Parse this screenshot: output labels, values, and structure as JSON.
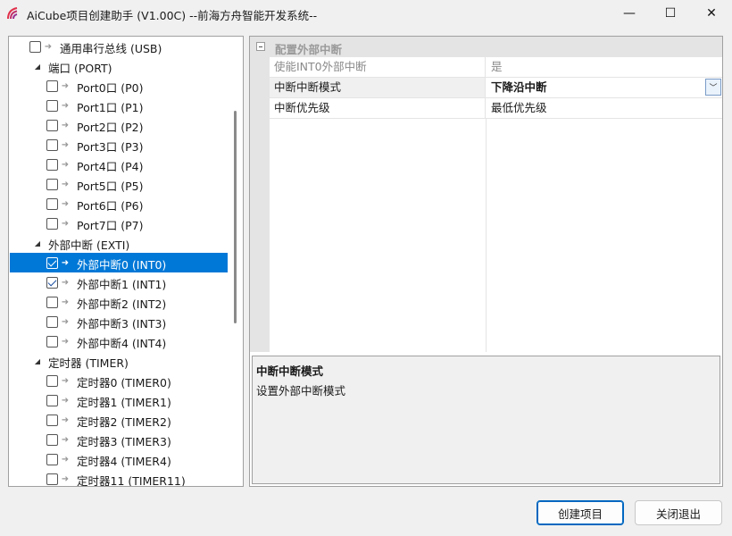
{
  "window": {
    "title": "AiCube项目创建助手 (V1.00C) --前海方舟智能开发系统--",
    "min_glyph": "—",
    "max_glyph": "☐",
    "close_glyph": "✕"
  },
  "tree": {
    "items": [
      {
        "label": "通用串行总线 (USB)",
        "checked": false,
        "level": 1,
        "type": "leaf",
        "selected": false
      },
      {
        "label": "端口 (PORT)",
        "level": 0,
        "type": "group",
        "expander": "◢"
      },
      {
        "label": "Port0口 (P0)",
        "checked": false,
        "level": 1,
        "type": "leaf",
        "selected": false
      },
      {
        "label": "Port1口 (P1)",
        "checked": false,
        "level": 1,
        "type": "leaf",
        "selected": false
      },
      {
        "label": "Port2口 (P2)",
        "checked": false,
        "level": 1,
        "type": "leaf",
        "selected": false
      },
      {
        "label": "Port3口 (P3)",
        "checked": false,
        "level": 1,
        "type": "leaf",
        "selected": false
      },
      {
        "label": "Port4口 (P4)",
        "checked": false,
        "level": 1,
        "type": "leaf",
        "selected": false
      },
      {
        "label": "Port5口 (P5)",
        "checked": false,
        "level": 1,
        "type": "leaf",
        "selected": false
      },
      {
        "label": "Port6口 (P6)",
        "checked": false,
        "level": 1,
        "type": "leaf",
        "selected": false
      },
      {
        "label": "Port7口 (P7)",
        "checked": false,
        "level": 1,
        "type": "leaf",
        "selected": false
      },
      {
        "label": "外部中断 (EXTI)",
        "level": 0,
        "type": "group",
        "expander": "◢"
      },
      {
        "label": "外部中断0 (INT0)",
        "checked": true,
        "level": 1,
        "type": "leaf",
        "selected": true
      },
      {
        "label": "外部中断1 (INT1)",
        "checked": true,
        "level": 1,
        "type": "leaf",
        "selected": false
      },
      {
        "label": "外部中断2 (INT2)",
        "checked": false,
        "level": 1,
        "type": "leaf",
        "selected": false
      },
      {
        "label": "外部中断3 (INT3)",
        "checked": false,
        "level": 1,
        "type": "leaf",
        "selected": false
      },
      {
        "label": "外部中断4 (INT4)",
        "checked": false,
        "level": 1,
        "type": "leaf",
        "selected": false
      },
      {
        "label": "定时器 (TIMER)",
        "level": 0,
        "type": "group",
        "expander": "◢"
      },
      {
        "label": "定时器0 (TIMER0)",
        "checked": false,
        "level": 1,
        "type": "leaf",
        "selected": false
      },
      {
        "label": "定时器1 (TIMER1)",
        "checked": false,
        "level": 1,
        "type": "leaf",
        "selected": false
      },
      {
        "label": "定时器2 (TIMER2)",
        "checked": false,
        "level": 1,
        "type": "leaf",
        "selected": false
      },
      {
        "label": "定时器3 (TIMER3)",
        "checked": false,
        "level": 1,
        "type": "leaf",
        "selected": false
      },
      {
        "label": "定时器4 (TIMER4)",
        "checked": false,
        "level": 1,
        "type": "leaf",
        "selected": false
      },
      {
        "label": "定时器11 (TIMER11)",
        "checked": false,
        "level": 1,
        "type": "leaf",
        "selected": false
      }
    ],
    "arrow_glyph": "➜"
  },
  "property_grid": {
    "category": "配置外部中断",
    "rows": [
      {
        "name": "使能INT0外部中断",
        "value": "是",
        "disabled": true
      },
      {
        "name": "中断中断模式",
        "value": "下降沿中断",
        "active": true,
        "dropdown_glyph": "﹀"
      },
      {
        "name": "中断优先级",
        "value": "最低优先级"
      }
    ],
    "description": {
      "title": "中断中断模式",
      "text": "设置外部中断模式"
    }
  },
  "buttons": {
    "create": "创建项目",
    "exit": "关闭退出"
  },
  "colors": {
    "selection": "#0078d7",
    "window_bg": "#f0f0f0",
    "category_bg": "#e4e4e4"
  }
}
